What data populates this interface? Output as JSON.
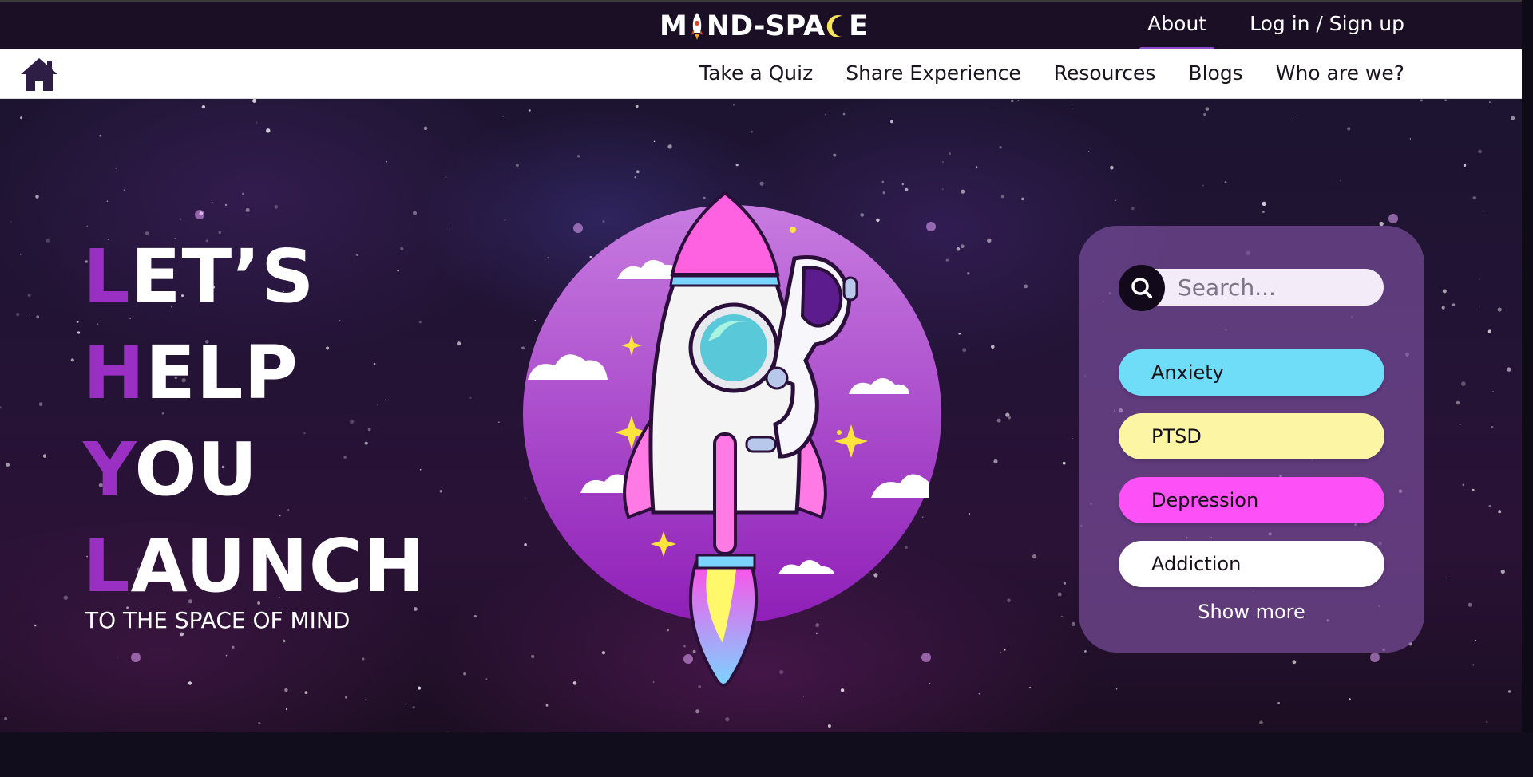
{
  "brand": {
    "logo_left": "M",
    "logo_mid": "ND-SPA",
    "logo_right": "E"
  },
  "top_nav": {
    "about": "About",
    "login": "Log in / Sign up"
  },
  "main_nav": {
    "items": [
      "Take a Quiz",
      "Share Experience",
      "Resources",
      "Blogs",
      "Who are we?"
    ]
  },
  "hero": {
    "lines": [
      {
        "first": "L",
        "rest": "ET’S"
      },
      {
        "first": "H",
        "rest": "ELP"
      },
      {
        "first": "Y",
        "rest": "OU"
      },
      {
        "first": "L",
        "rest": "AUNCH"
      }
    ],
    "subtitle": "TO THE SPACE OF MIND"
  },
  "search": {
    "placeholder": "Search..."
  },
  "topics": [
    {
      "label": "Anxiety",
      "color": "#6fdcf8"
    },
    {
      "label": "PTSD",
      "color": "#fcf5a3"
    },
    {
      "label": "Depression",
      "color": "#fd50f6"
    },
    {
      "label": "Addiction",
      "color": "#ffffff"
    }
  ],
  "show_more": "Show more",
  "colors": {
    "accent_purple": "#9a2fc4",
    "topbar": "#1a0f24",
    "active_underline": "#8e4ccf"
  }
}
